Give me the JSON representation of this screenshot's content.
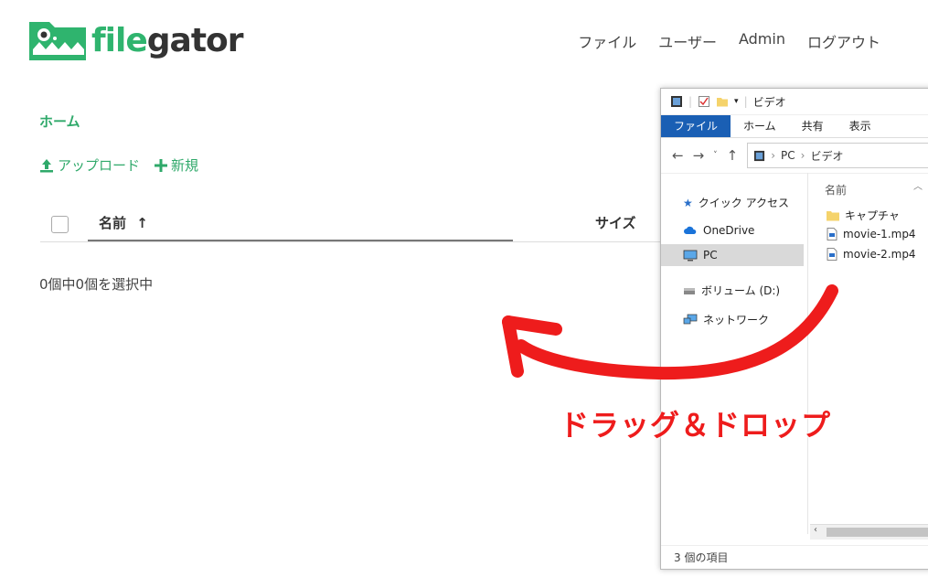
{
  "logo": {
    "part1": "file",
    "part2": "gator",
    "brand_color": "#2fb46e"
  },
  "nav": {
    "files": "ファイル",
    "users": "ユーザー",
    "admin": "Admin",
    "logout": "ログアウト"
  },
  "breadcrumb": {
    "home": "ホーム"
  },
  "actions": {
    "upload": "アップロード",
    "new": "新規"
  },
  "table": {
    "col_name": "名前",
    "sort_icon": "↑",
    "col_size": "サイズ"
  },
  "selection_info": "0個中0個を選択中",
  "explorer": {
    "title": "ビデオ",
    "ribbon": [
      "ファイル",
      "ホーム",
      "共有",
      "表示"
    ],
    "path": [
      "PC",
      "ビデオ"
    ],
    "nav_items": [
      "クイック アクセス",
      "OneDrive",
      "PC",
      "ボリューム (D:)",
      "ネットワーク"
    ],
    "column": "名前",
    "files": [
      "キャプチャ",
      "movie-1.mp4",
      "movie-2.mp4"
    ],
    "status": "3 個の項目"
  },
  "annotation": {
    "label": "ドラッグ＆ドロップ",
    "color": "#ee1c1c"
  }
}
